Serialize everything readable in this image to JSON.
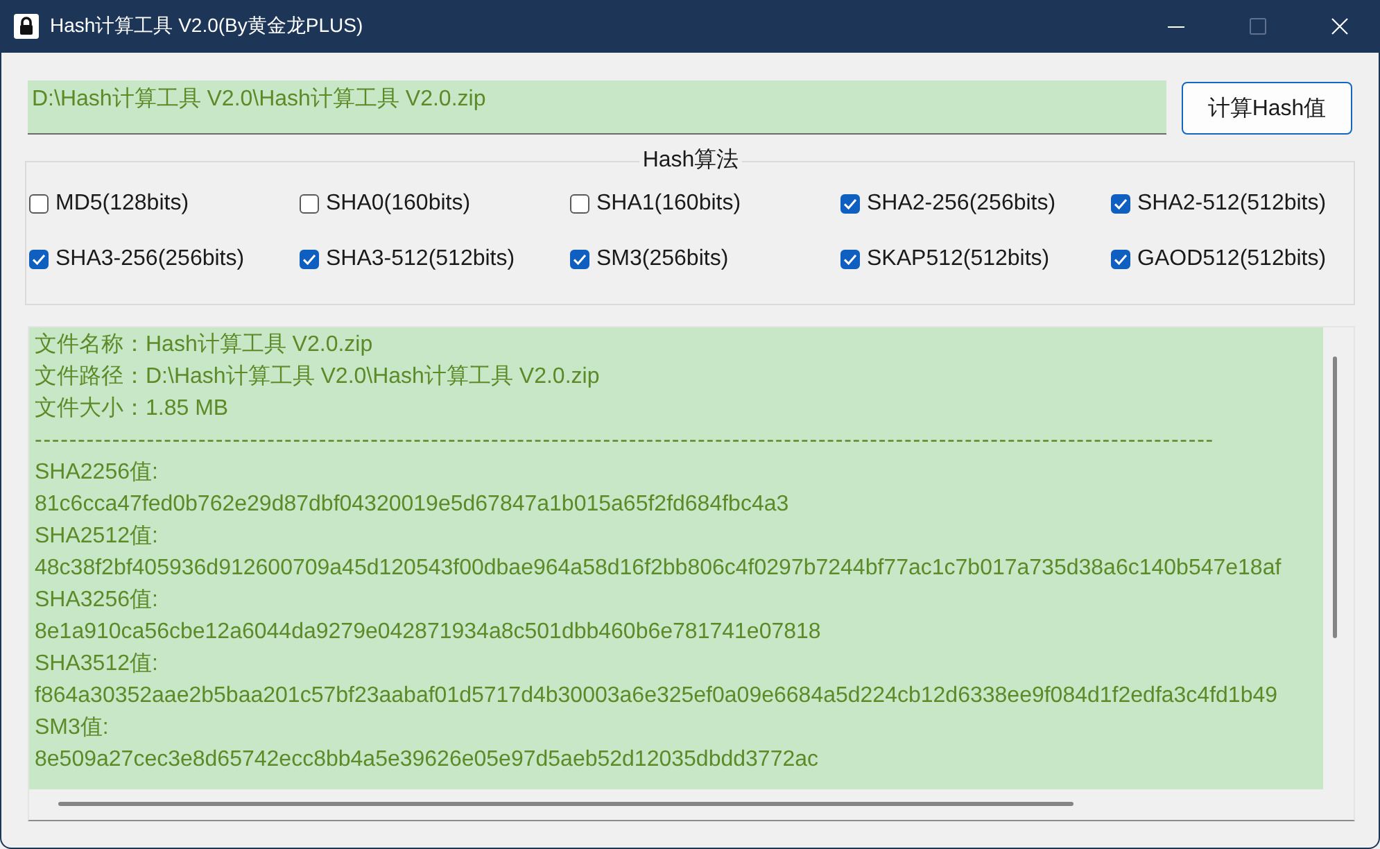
{
  "window": {
    "title": "Hash计算工具 V2.0(By黄金龙PLUS)",
    "maximize_disabled": true
  },
  "file_path": {
    "value": "D:\\Hash计算工具 V2.0\\Hash计算工具 V2.0.zip"
  },
  "compute_button": "计算Hash值",
  "algorithms": {
    "title": "Hash算法",
    "options": [
      {
        "label": "MD5(128bits)",
        "checked": false
      },
      {
        "label": "SHA0(160bits)",
        "checked": false
      },
      {
        "label": "SHA1(160bits)",
        "checked": false
      },
      {
        "label": "SHA2-256(256bits)",
        "checked": true
      },
      {
        "label": "SHA2-512(512bits)",
        "checked": true
      },
      {
        "label": "SHA3-256(256bits)",
        "checked": true
      },
      {
        "label": "SHA3-512(512bits)",
        "checked": true
      },
      {
        "label": "SM3(256bits)",
        "checked": true
      },
      {
        "label": "SKAP512(512bits)",
        "checked": true
      },
      {
        "label": "GAOD512(512bits)",
        "checked": true
      }
    ]
  },
  "output": {
    "lines": [
      {
        "kind": "text",
        "text": "文件名称：Hash计算工具 V2.0.zip"
      },
      {
        "kind": "text",
        "text": "文件路径：D:\\Hash计算工具 V2.0\\Hash计算工具 V2.0.zip"
      },
      {
        "kind": "text",
        "text": "文件大小：1.85 MB"
      },
      {
        "kind": "rule",
        "text": "-----------------------------------------------------------------------------------------------------------------------------------------"
      },
      {
        "kind": "text",
        "text": "SHA2256值:"
      },
      {
        "kind": "text",
        "text": "81c6cca47fed0b762e29d87dbf04320019e5d67847a1b015a65f2fd684fbc4a3"
      },
      {
        "kind": "text",
        "text": "SHA2512值:"
      },
      {
        "kind": "text",
        "text": "48c38f2bf405936d912600709a45d120543f00dbae964a58d16f2bb806c4f0297b7244bf77ac1c7b017a735d38a6c140b547e18af"
      },
      {
        "kind": "text",
        "text": "SHA3256值:"
      },
      {
        "kind": "text",
        "text": "8e1a910ca56cbe12a6044da9279e042871934a8c501dbb460b6e781741e07818"
      },
      {
        "kind": "text",
        "text": "SHA3512值:"
      },
      {
        "kind": "text",
        "text": "f864a30352aae2b5baa201c57bf23aabaf01d5717d4b30003a6e325ef0a09e6684a5d224cb12d6338ee9f084d1f2edfa3c4fd1b49"
      },
      {
        "kind": "text",
        "text": "SM3值:"
      },
      {
        "kind": "text",
        "text": "8e509a27cec3e8d65742ecc8bb4a5e39626e05e97d5aeb52d12035dbdd3772ac"
      }
    ]
  }
}
